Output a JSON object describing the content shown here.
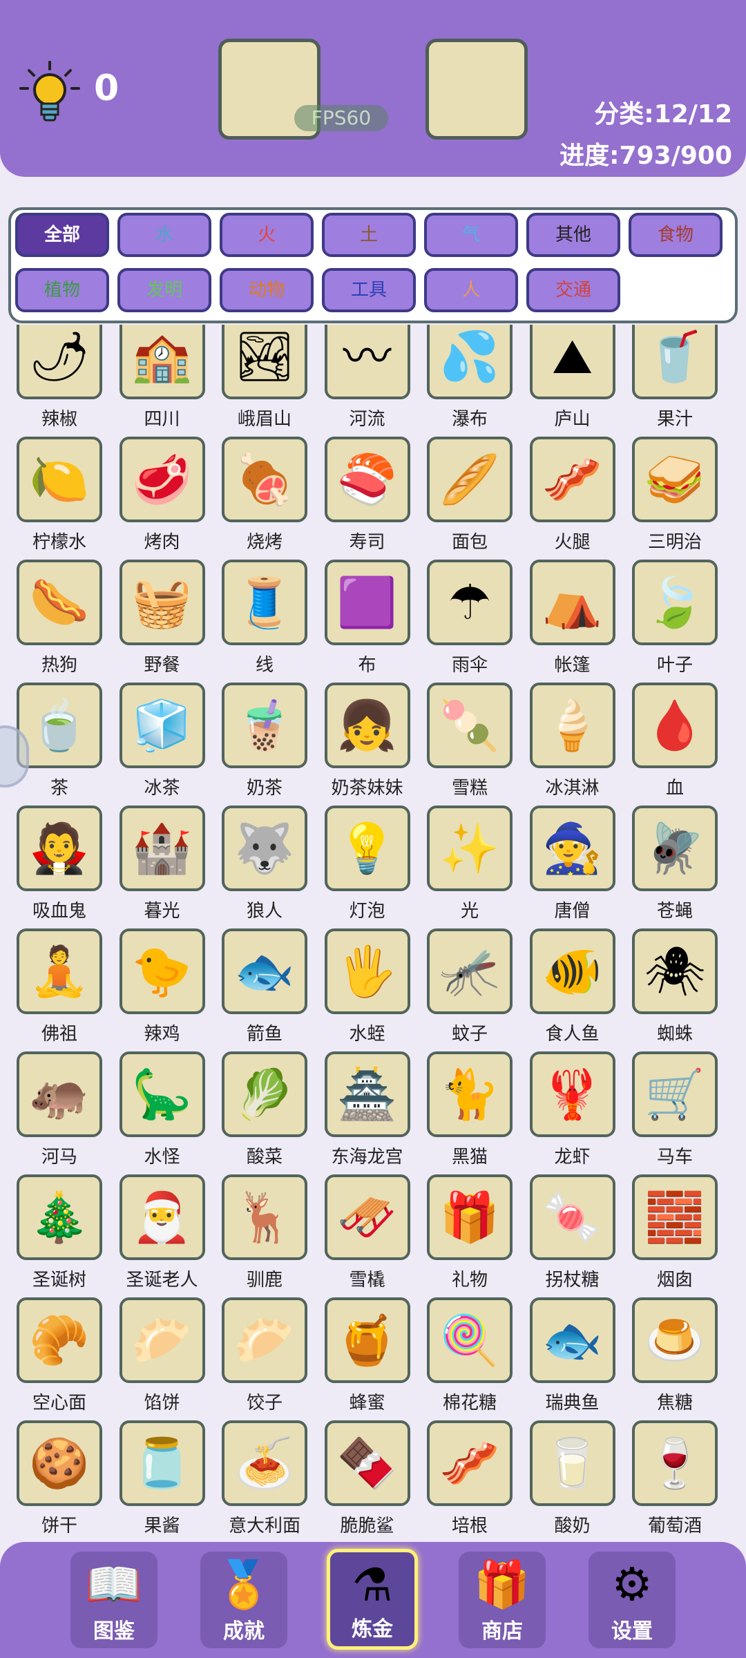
{
  "header": {
    "hint_count": "0",
    "fps_label": "FPS60",
    "category_progress": "分类:12/12",
    "overall_progress": "进度:793/900"
  },
  "filters": [
    {
      "label": "全部",
      "color": "#ffffff",
      "active": true
    },
    {
      "label": "水",
      "color": "#4aa7c9"
    },
    {
      "label": "火",
      "color": "#e8433a"
    },
    {
      "label": "土",
      "color": "#8a5a2e"
    },
    {
      "label": "气",
      "color": "#4fb3e8"
    },
    {
      "label": "其他",
      "color": "#222222"
    },
    {
      "label": "食物",
      "color": "#a43c32"
    },
    {
      "label": "植物",
      "color": "#3d9a46"
    },
    {
      "label": "发明",
      "color": "#64c65c"
    },
    {
      "label": "动物",
      "color": "#e07a22"
    },
    {
      "label": "工具",
      "color": "#2f3fb4"
    },
    {
      "label": "人",
      "color": "#e99a55"
    },
    {
      "label": "交通",
      "color": "#d2413d"
    }
  ],
  "items": [
    {
      "label": "辣椒",
      "icon": "🌶"
    },
    {
      "label": "四川",
      "icon": "🏫"
    },
    {
      "label": "峨眉山",
      "icon": "🏞"
    },
    {
      "label": "河流",
      "icon": "〰"
    },
    {
      "label": "瀑布",
      "icon": "💦"
    },
    {
      "label": "庐山",
      "icon": "⛰"
    },
    {
      "label": "果汁",
      "icon": "🥤"
    },
    {
      "label": "柠檬水",
      "icon": "🍋"
    },
    {
      "label": "烤肉",
      "icon": "🥩"
    },
    {
      "label": "烧烤",
      "icon": "🍖"
    },
    {
      "label": "寿司",
      "icon": "🍣"
    },
    {
      "label": "面包",
      "icon": "🥖"
    },
    {
      "label": "火腿",
      "icon": "🥓"
    },
    {
      "label": "三明治",
      "icon": "🥪"
    },
    {
      "label": "热狗",
      "icon": "🌭"
    },
    {
      "label": "野餐",
      "icon": "🧺"
    },
    {
      "label": "线",
      "icon": "🧵"
    },
    {
      "label": "布",
      "icon": "🟪"
    },
    {
      "label": "雨伞",
      "icon": "☂"
    },
    {
      "label": "帐篷",
      "icon": "⛺"
    },
    {
      "label": "叶子",
      "icon": "🍃"
    },
    {
      "label": "茶",
      "icon": "🍵"
    },
    {
      "label": "冰茶",
      "icon": "🧊"
    },
    {
      "label": "奶茶",
      "icon": "🧋"
    },
    {
      "label": "奶茶妹妹",
      "icon": "👧"
    },
    {
      "label": "雪糕",
      "icon": "🍡"
    },
    {
      "label": "冰淇淋",
      "icon": "🍦"
    },
    {
      "label": "血",
      "icon": "🩸"
    },
    {
      "label": "吸血鬼",
      "icon": "🧛"
    },
    {
      "label": "暮光",
      "icon": "🏰"
    },
    {
      "label": "狼人",
      "icon": "🐺"
    },
    {
      "label": "灯泡",
      "icon": "💡"
    },
    {
      "label": "光",
      "icon": "✨"
    },
    {
      "label": "唐僧",
      "icon": "🧙"
    },
    {
      "label": "苍蝇",
      "icon": "🪰"
    },
    {
      "label": "佛祖",
      "icon": "🧘"
    },
    {
      "label": "辣鸡",
      "icon": "🐤"
    },
    {
      "label": "箭鱼",
      "icon": "🐟"
    },
    {
      "label": "水蛭",
      "icon": "🖐"
    },
    {
      "label": "蚊子",
      "icon": "🦟"
    },
    {
      "label": "食人鱼",
      "icon": "🐠"
    },
    {
      "label": "蜘蛛",
      "icon": "🕷"
    },
    {
      "label": "河马",
      "icon": "🦛"
    },
    {
      "label": "水怪",
      "icon": "🦕"
    },
    {
      "label": "酸菜",
      "icon": "🥬"
    },
    {
      "label": "东海龙宫",
      "icon": "🏯"
    },
    {
      "label": "黑猫",
      "icon": "🐈"
    },
    {
      "label": "龙虾",
      "icon": "🦞"
    },
    {
      "label": "马车",
      "icon": "🛒"
    },
    {
      "label": "圣诞树",
      "icon": "🎄"
    },
    {
      "label": "圣诞老人",
      "icon": "🎅"
    },
    {
      "label": "驯鹿",
      "icon": "🦌"
    },
    {
      "label": "雪橇",
      "icon": "🛷"
    },
    {
      "label": "礼物",
      "icon": "🎁"
    },
    {
      "label": "拐杖糖",
      "icon": "🍬"
    },
    {
      "label": "烟囱",
      "icon": "🧱"
    },
    {
      "label": "空心面",
      "icon": "🥐"
    },
    {
      "label": "馅饼",
      "icon": "🥟"
    },
    {
      "label": "饺子",
      "icon": "🥟"
    },
    {
      "label": "蜂蜜",
      "icon": "🍯"
    },
    {
      "label": "棉花糖",
      "icon": "🍭"
    },
    {
      "label": "瑞典鱼",
      "icon": "🐟"
    },
    {
      "label": "焦糖",
      "icon": "🍮"
    },
    {
      "label": "饼干",
      "icon": "🍪"
    },
    {
      "label": "果酱",
      "icon": "🫙"
    },
    {
      "label": "意大利面",
      "icon": "🍝"
    },
    {
      "label": "脆脆鲨",
      "icon": "🍫"
    },
    {
      "label": "培根",
      "icon": "🥓"
    },
    {
      "label": "酸奶",
      "icon": "🥛"
    },
    {
      "label": "葡萄酒",
      "icon": "🍷"
    }
  ],
  "nav": [
    {
      "label": "图鉴",
      "icon": "📖",
      "name": "book-icon"
    },
    {
      "label": "成就",
      "icon": "🏅",
      "name": "medal-icon"
    },
    {
      "label": "炼金",
      "icon": "⚗",
      "name": "flask-icon",
      "active": true
    },
    {
      "label": "商店",
      "icon": "🎁",
      "name": "gift-icon"
    },
    {
      "label": "设置",
      "icon": "⚙",
      "name": "gear-icon"
    }
  ]
}
